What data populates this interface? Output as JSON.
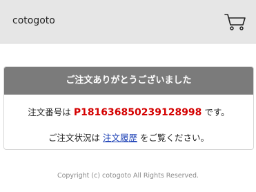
{
  "header": {
    "brand": "cotogoto",
    "cart_icon": "cart-icon"
  },
  "confirmation": {
    "title": "ご注文ありがとうございました",
    "order_prefix": "注文番号は",
    "order_number": "P181636850239128998",
    "order_suffix": "です。",
    "status_prefix": "ご注文状況は",
    "history_link": "注文履歴",
    "status_suffix": "をご覧ください。"
  },
  "footer": {
    "copyright": "Copyright (c) cotogoto All Rights Reserved."
  },
  "colors": {
    "header_bg": "#e6e6e6",
    "card_header_bg": "#7b7b7b",
    "order_number": "#d40000",
    "link": "#1a3fb5",
    "footer_text": "#8a8a8a"
  }
}
